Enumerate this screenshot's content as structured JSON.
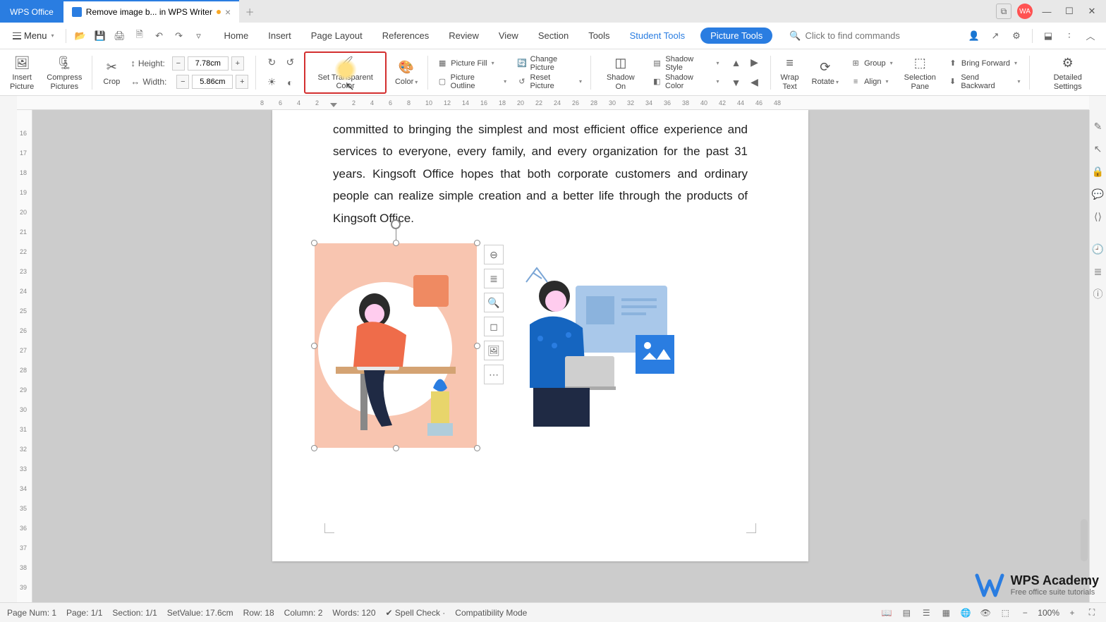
{
  "titlebar": {
    "app_tab": "WPS Office",
    "doc_tab": "Remove image b... in WPS Writer",
    "avatar_initials": "WA"
  },
  "qa": {
    "menu_label": "Menu",
    "tabs": [
      "Home",
      "Insert",
      "Page Layout",
      "References",
      "Review",
      "View",
      "Section",
      "Tools"
    ],
    "student_tools": "Student Tools",
    "picture_tools": "Picture Tools",
    "search_placeholder": "Click to find commands"
  },
  "ribbon": {
    "insert_picture": "Insert\nPicture",
    "compress_pictures": "Compress\nPictures",
    "crop": "Crop",
    "height_label": "Height:",
    "height_val": "7.78cm",
    "width_label": "Width:",
    "width_val": "5.86cm",
    "set_transparent": "Set Transparent Color",
    "color": "Color",
    "picture_fill": "Picture Fill",
    "picture_outline": "Picture Outline",
    "change_picture": "Change Picture",
    "reset_picture": "Reset Picture",
    "shadow_on": "Shadow On",
    "shadow_style": "Shadow Style",
    "shadow_color": "Shadow Color",
    "wrap_text": "Wrap\nText",
    "rotate": "Rotate",
    "group": "Group",
    "align": "Align",
    "selection_pane": "Selection\nPane",
    "bring_forward": "Bring Forward",
    "send_backward": "Send Backward",
    "detailed_settings": "Detailed Settings"
  },
  "ruler_h": [
    "8",
    "6",
    "4",
    "2",
    "",
    "2",
    "4",
    "6",
    "8",
    "10",
    "12",
    "14",
    "16",
    "18",
    "20",
    "22",
    "24",
    "26",
    "28",
    "30",
    "32",
    "34",
    "36",
    "38",
    "40",
    "42",
    "44",
    "46",
    "48"
  ],
  "ruler_v": [
    "",
    "16",
    "17",
    "18",
    "19",
    "20",
    "21",
    "22",
    "23",
    "24",
    "25",
    "26",
    "27",
    "28",
    "29",
    "30",
    "31",
    "32",
    "33",
    "34",
    "35",
    "36",
    "37",
    "38",
    "39"
  ],
  "doc_text": "committed to bringing the simplest and most efficient office experience and services to everyone, every family, and every organization for the past 31 years. Kingsoft Office hopes that both corporate customers and ordinary people can realize simple creation and a better life through the products of Kingsoft Office.",
  "statusbar": {
    "page_num": "Page Num: 1",
    "page": "Page: 1/1",
    "section": "Section: 1/1",
    "setvalue": "SetValue: 17.6cm",
    "row": "Row: 18",
    "column": "Column: 2",
    "words": "Words: 120",
    "spellcheck": "Spell Check",
    "compat": "Compatibility Mode",
    "zoom": "100%"
  },
  "academy": {
    "title": "WPS Academy",
    "sub": "Free office suite tutorials"
  }
}
